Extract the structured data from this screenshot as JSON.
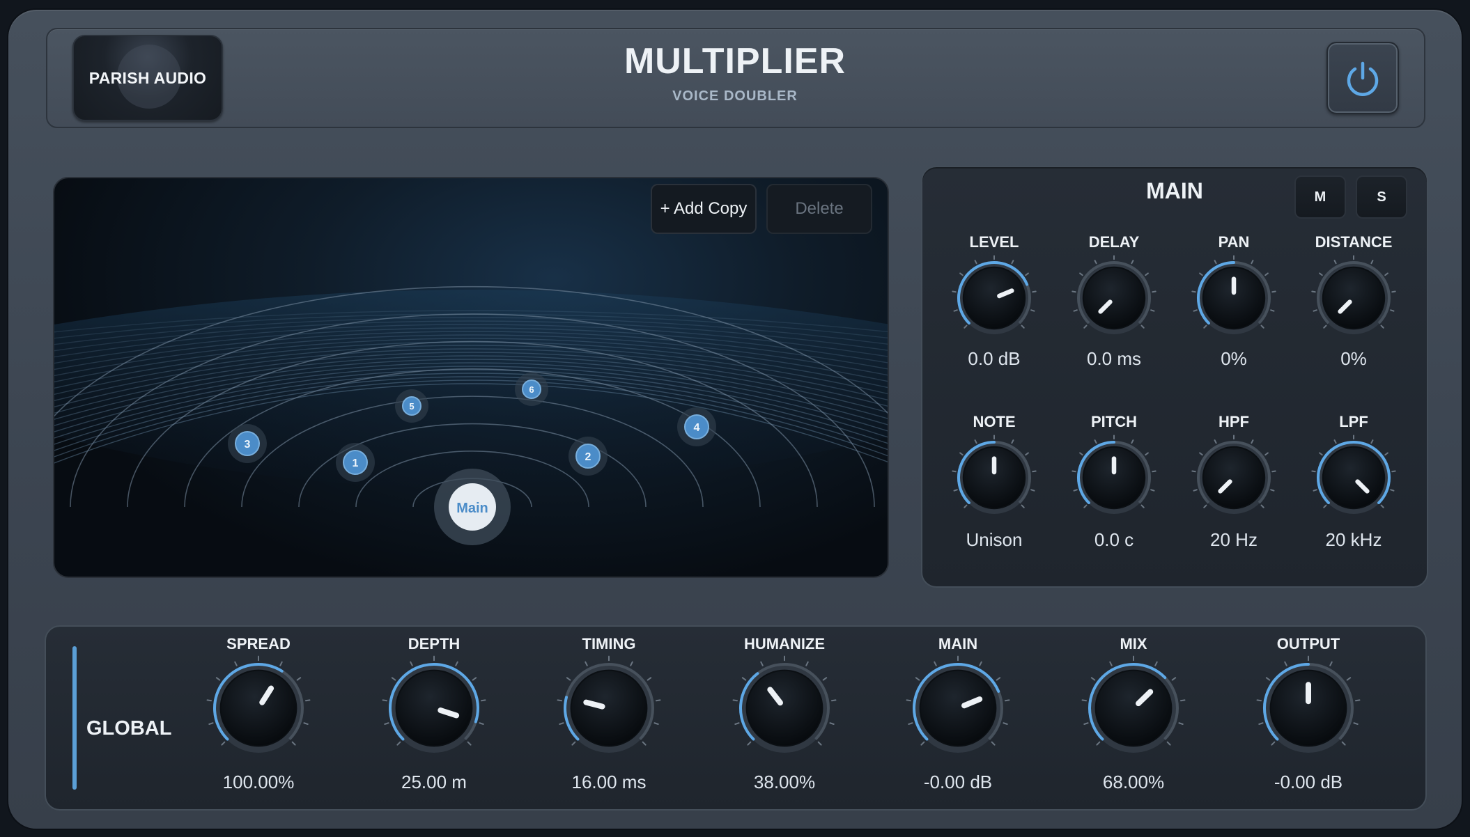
{
  "header": {
    "brand": "PARISH AUDIO",
    "title": "MULTIPLIER",
    "subtitle": "VOICE DOUBLER",
    "power_icon": "power-icon"
  },
  "stage": {
    "add_label": "+ Add Copy",
    "delete_label": "Delete",
    "main_label": "Main",
    "voices": [
      "1",
      "2",
      "3",
      "4",
      "5",
      "6"
    ]
  },
  "main_panel": {
    "title": "MAIN",
    "mute_label": "M",
    "solo_label": "S",
    "knobs": [
      {
        "label": "LEVEL",
        "value": "0.0 dB",
        "level": 0.75
      },
      {
        "label": "DELAY",
        "value": "0.0 ms",
        "level": 0.0
      },
      {
        "label": "PAN",
        "value": "0%",
        "level": 0.5
      },
      {
        "label": "DISTANCE",
        "value": "0%",
        "level": 0.0
      },
      {
        "label": "NOTE",
        "value": "Unison",
        "level": 0.5
      },
      {
        "label": "PITCH",
        "value": "0.0 c",
        "level": 0.5
      },
      {
        "label": "HPF",
        "value": "20 Hz",
        "level": 0.0
      },
      {
        "label": "LPF",
        "value": "20 kHz",
        "level": 1.0
      }
    ]
  },
  "global": {
    "title": "GLOBAL",
    "knobs": [
      {
        "label": "SPREAD",
        "value": "100.00%",
        "level": 0.62
      },
      {
        "label": "DEPTH",
        "value": "25.00 m",
        "level": 0.9
      },
      {
        "label": "TIMING",
        "value": "16.00 ms",
        "level": 0.22
      },
      {
        "label": "HUMANIZE",
        "value": "38.00%",
        "level": 0.36
      },
      {
        "label": "MAIN",
        "value": "-0.00 dB",
        "level": 0.75
      },
      {
        "label": "MIX",
        "value": "68.00%",
        "level": 0.67
      },
      {
        "label": "OUTPUT",
        "value": "-0.00 dB",
        "level": 0.5
      }
    ]
  },
  "colors": {
    "accent": "#5b9fd6",
    "voice_dot": "#4b8cc8"
  }
}
